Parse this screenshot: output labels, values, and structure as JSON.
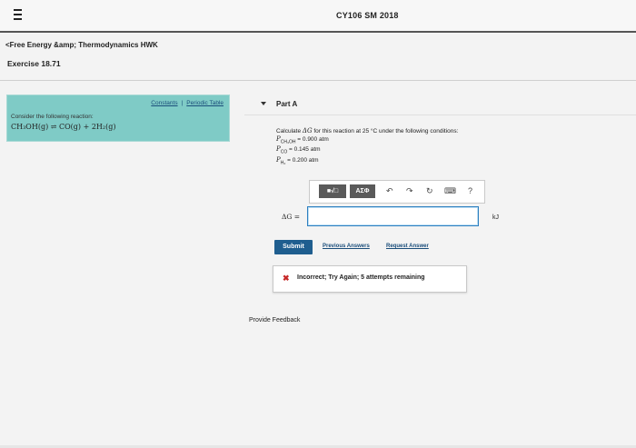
{
  "header": {
    "course_title": "CY106 SM 2018"
  },
  "breadcrumb": {
    "text": "<Free Energy &amp; Thermodynamics HWK"
  },
  "exercise": {
    "title": "Exercise 18.71"
  },
  "left_panel": {
    "constants_link": "Constants",
    "separator": "|",
    "periodic_table_link": "Periodic Table",
    "intro": "Consider the following reaction:",
    "reaction": "CH₃OH(g) ⇌ CO(g) + 2H₂(g)"
  },
  "part": {
    "label": "Part A"
  },
  "question": {
    "prompt_pre": "Calculate ",
    "prompt_var": "ΔG",
    "prompt_post": " for this reaction at 25 °C under the following conditions:",
    "conditions": [
      {
        "symbol": "P",
        "sub": "CH₃OH",
        "value": " = 0.900 atm"
      },
      {
        "symbol": "P",
        "sub": "CO",
        "value": " = 0.145 atm"
      },
      {
        "symbol": "P",
        "sub": "H₂",
        "value": " = 0.200 atm"
      }
    ]
  },
  "toolbar": {
    "templates_label": "■√□",
    "symbols_label": "ΑΣΦ",
    "undo_icon": "↶",
    "redo_icon": "↷",
    "reset_icon": "↻",
    "keyboard_icon": "⌨",
    "help_icon": "?"
  },
  "answer": {
    "label": "ΔG =",
    "value": "",
    "unit": "kJ"
  },
  "actions": {
    "submit_label": "Submit",
    "previous_answers_label": "Previous Answers",
    "request_answer_label": "Request Answer"
  },
  "feedback": {
    "icon": "✖",
    "message": "Incorrect; Try Again; 5 attempts remaining",
    "status_color": "#c62828"
  },
  "footer": {
    "provide_feedback": "Provide Feedback"
  },
  "colors": {
    "panel_accent": "#7fcbc6",
    "submit": "#1f5e8f",
    "link": "#1a4d7a",
    "input_border": "#2d7fbf"
  }
}
